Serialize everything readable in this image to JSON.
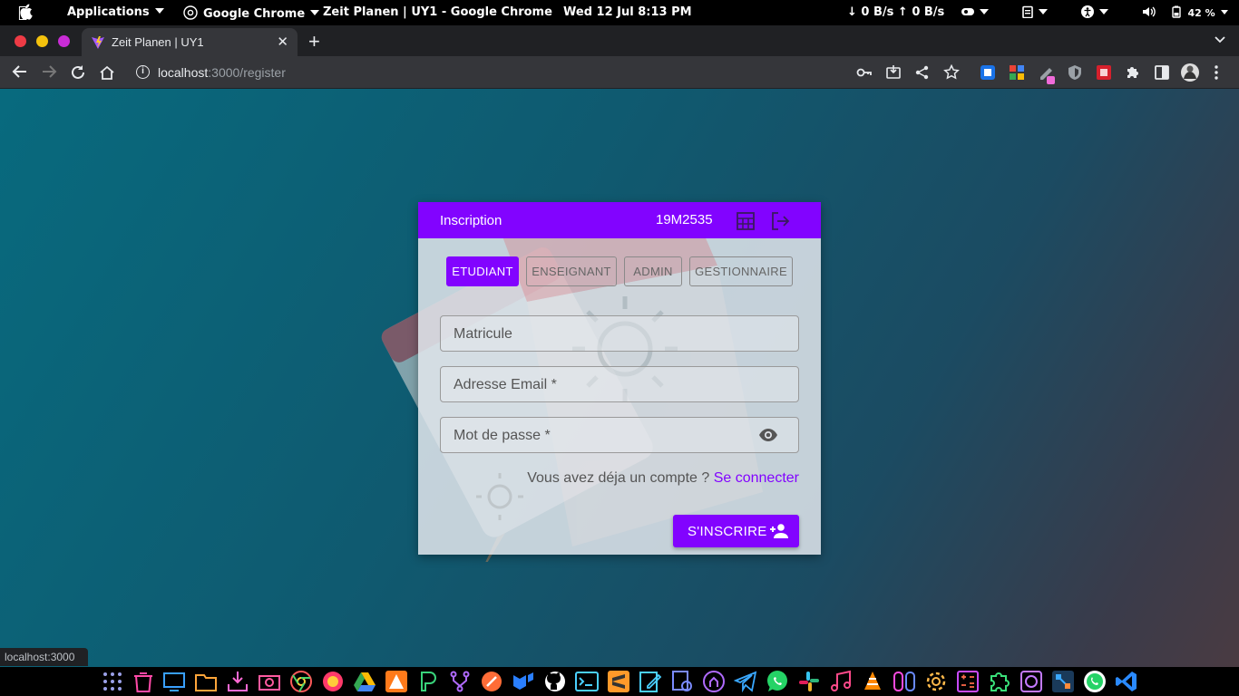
{
  "system_bar": {
    "applications": "Applications",
    "chrome_menu": "Google Chrome",
    "window_title": "Zeit Planen | UY1 - Google Chrome",
    "datetime": "Wed 12 Jul   8:13 PM",
    "network": "↓ 0 B/s ↑ 0 B/s",
    "battery": "42 %"
  },
  "browser": {
    "tab_title": "Zeit Planen | UY1",
    "url_host": "localhost",
    "url_path": ":3000/register",
    "status_url": "localhost:3000"
  },
  "card": {
    "header_title": "Inscription",
    "header_code": "19M2535",
    "roles": [
      "ETUDIANT",
      "ENSEIGNANT",
      "ADMIN",
      "GESTIONNAIRE"
    ],
    "active_role": "ETUDIANT",
    "fields": {
      "matricule": "Matricule",
      "email": "Adresse Email *",
      "password": "Mot de passe *"
    },
    "login_prompt": "Vous avez déja un compte ?",
    "login_link": "Se connecter",
    "submit_label": "S'INSCRIRE"
  },
  "colors": {
    "primary": "#8203ff",
    "page_bg": "#086a7e"
  }
}
